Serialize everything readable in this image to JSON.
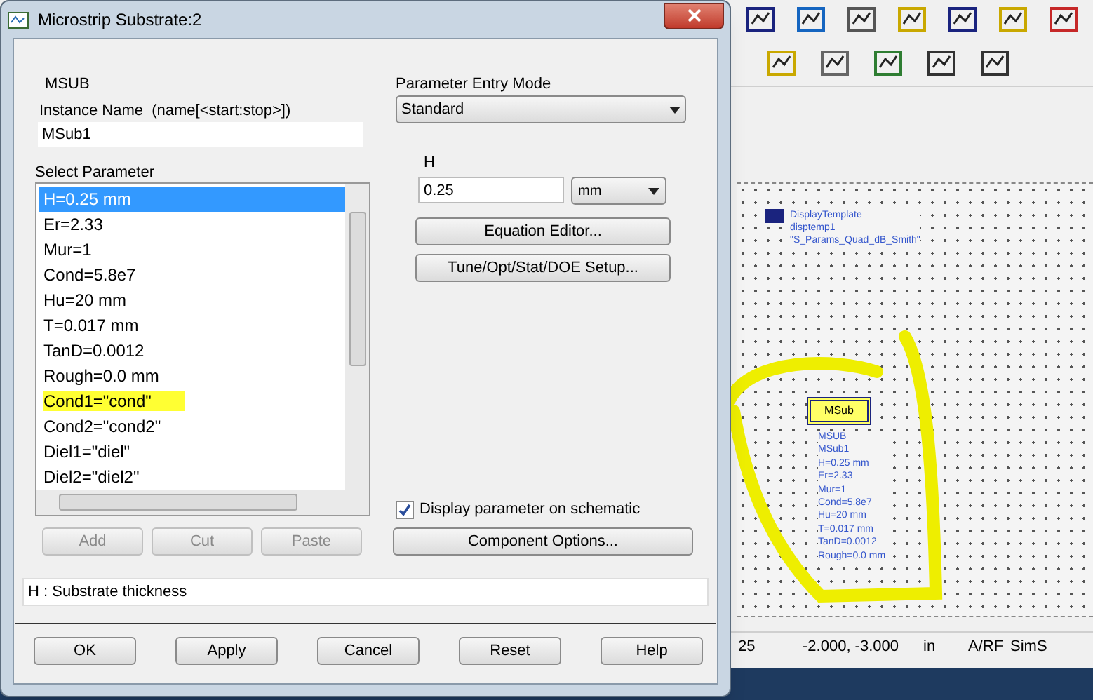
{
  "dialog": {
    "title": "Microstrip Substrate:2",
    "component": "MSUB",
    "instance_name_label": "Instance Name  (name[<start:stop>])",
    "instance_name": "MSub1",
    "select_parameter_label": "Select Parameter",
    "parameters": [
      {
        "label": "H=0.25 mm",
        "selected": true,
        "highlighted": false
      },
      {
        "label": "Er=2.33",
        "selected": false,
        "highlighted": false
      },
      {
        "label": "Mur=1",
        "selected": false,
        "highlighted": false
      },
      {
        "label": "Cond=5.8e7",
        "selected": false,
        "highlighted": false
      },
      {
        "label": "Hu=20 mm",
        "selected": false,
        "highlighted": false
      },
      {
        "label": "T=0.017 mm",
        "selected": false,
        "highlighted": false
      },
      {
        "label": "TanD=0.0012",
        "selected": false,
        "highlighted": false
      },
      {
        "label": "Rough=0.0 mm",
        "selected": false,
        "highlighted": false
      },
      {
        "label": "Cond1=\"cond\"",
        "selected": false,
        "highlighted": true
      },
      {
        "label": "Cond2=\"cond2\"",
        "selected": false,
        "highlighted": false
      },
      {
        "label": "Diel1=\"diel\"",
        "selected": false,
        "highlighted": false
      },
      {
        "label": "Diel2=\"diel2\"",
        "selected": false,
        "highlighted": false
      }
    ],
    "list_buttons": [
      {
        "label": "Add",
        "disabled": true
      },
      {
        "label": "Cut",
        "disabled": true
      },
      {
        "label": "Paste",
        "disabled": true
      }
    ],
    "entry_mode_label": "Parameter Entry Mode",
    "entry_mode": "Standard",
    "param_name": "H",
    "param_value": "0.25",
    "unit": "mm",
    "edit_buttons": [
      "Equation Editor...",
      "Tune/Opt/Stat/DOE Setup..."
    ],
    "display_on_schematic": {
      "label": "Display parameter on schematic",
      "checked": true
    },
    "component_options": "Component Options...",
    "description": "H : Substrate thickness",
    "footer_buttons": [
      "OK",
      "Apply",
      "Cancel",
      "Reset",
      "Help"
    ]
  },
  "schematic": {
    "display_template": [
      "DisplayTemplate",
      "disptemp1",
      "\"S_Params_Quad_dB_Smith\""
    ],
    "symbol_label": "MSub",
    "component_lines": [
      "MSUB",
      "MSub1",
      "H=0.25 mm",
      "Er=2.33",
      "Mur=1",
      "Cond=5.8e7",
      "Hu=20 mm",
      "T=0.017 mm",
      "TanD=0.0012",
      "Rough=0.0 mm"
    ]
  },
  "status_bar": [
    "25",
    "-2.000, -3.000",
    "in",
    "A/RF",
    "SimS"
  ]
}
